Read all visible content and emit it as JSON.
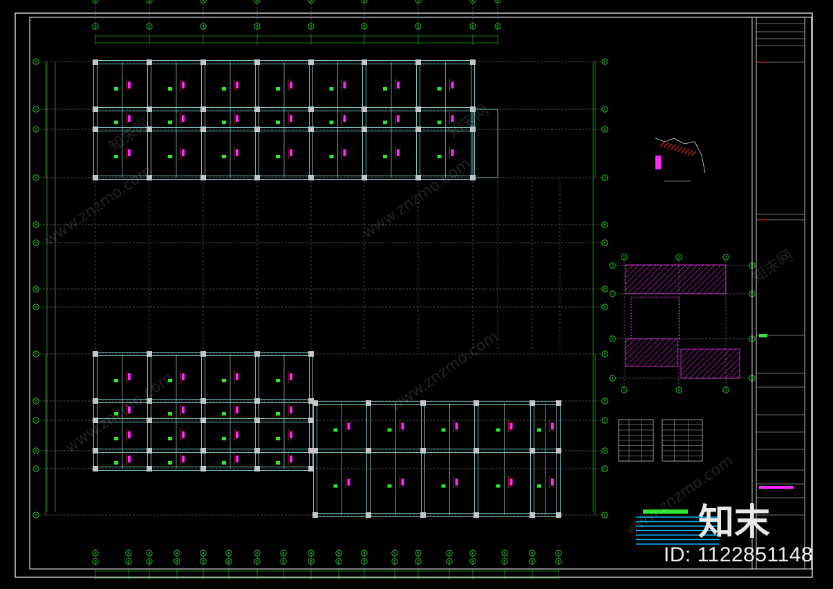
{
  "drawing": {
    "plan_top": {
      "col_bubbles": [
        "①",
        "②",
        "③",
        "④",
        "⑤",
        "⑥",
        "⑦",
        "⑧",
        "⑨",
        "⑩"
      ],
      "row_bubbles": [
        "Ⓓ",
        "Ⓒ",
        "Ⓑ",
        "Ⓐ"
      ]
    },
    "plan_mid": {
      "row_bubbles": [
        "Ⓓ",
        "Ⓒ",
        "Ⓑ",
        "Ⓐ"
      ]
    },
    "plan_bottom": {
      "col_bubbles": [
        "①",
        "②",
        "③",
        "④",
        "⑤",
        "⑥",
        "⑦",
        "⑧",
        "⑨",
        "⑩",
        "⑪"
      ],
      "row_bubbles": [
        "Ⓔ",
        "Ⓓ",
        "Ⓒ",
        "Ⓑ",
        "Ⓐ"
      ]
    },
    "small_plan": {
      "col_bubbles": [
        "①",
        "②",
        "③"
      ],
      "row_bubbles": [
        "Ⓓ",
        "Ⓒ",
        "Ⓑ",
        "Ⓐ"
      ]
    }
  },
  "branding": {
    "logo_cn": "知末",
    "id_label": "ID: 1122851148",
    "watermark_cn": "知末网",
    "watermark_url": "www.znzmo.com"
  },
  "colors": {
    "background": "#000000",
    "frame": "#ffffff",
    "beam": "#7fd4d4",
    "axis": "#2ee82e",
    "label": "#ff28ff",
    "rebar": "#ff3030",
    "column": "#c8c8c8"
  }
}
